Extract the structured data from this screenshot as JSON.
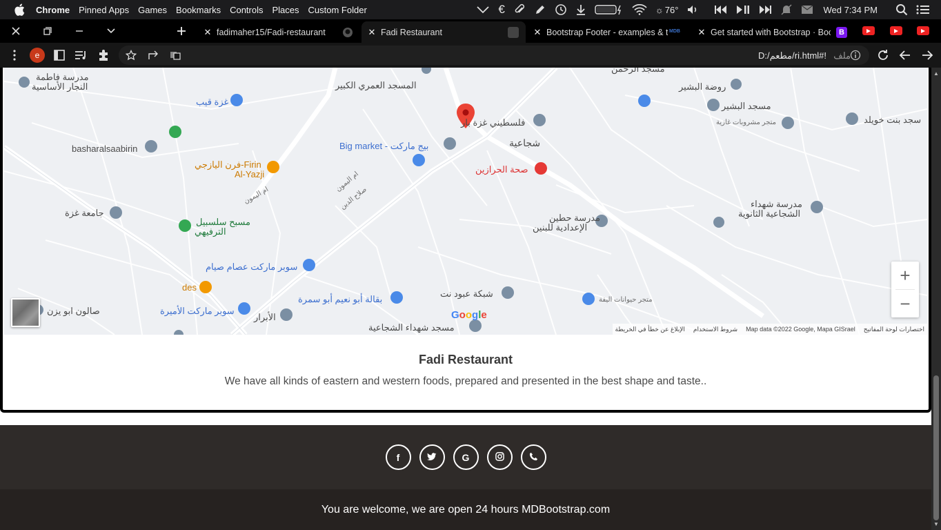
{
  "menubar": {
    "app": "Chrome",
    "items": [
      "Pinned Apps",
      "Games",
      "Bookmarks",
      "Controls",
      "Places",
      "Custom Folder"
    ],
    "weather": "76°",
    "clock": "Wed 7:34 PM"
  },
  "tabs": [
    {
      "title": "fadimaher15/Fadi-restaurant",
      "favicon": "github-icon"
    },
    {
      "title": "Fadi Restaurant",
      "favicon": "page-icon",
      "active": true
    },
    {
      "title": "Bootstrap Footer - examples & tu",
      "favicon": "mdb-icon"
    },
    {
      "title": "Get started with Bootstrap · Boot",
      "favicon": "bootstrap-icon"
    }
  ],
  "toolbar": {
    "profile_initial": "e",
    "file_label": "ملف",
    "url": "D:/مطعم/ri.html#!"
  },
  "map": {
    "labels": {
      "school_fatima": "مدرسة فاطمة",
      "school_fatima2": "النجار الأساسية",
      "omari_mosque": "المسجد العمري الكبير",
      "gaza_gift": "غزة قيب",
      "basharalsaabirin": "basharalsaabirin",
      "firin1": "فرن اليازجي-Firin",
      "firin2": "Al-Yazji",
      "big_market": "Big market - بيج ماركت",
      "palestinian_gaza": "فلسطيني غزة بار",
      "shujaiya": "شجاعية",
      "sihat": "صحة الحرازين",
      "bashir_garden": "روضة البشير",
      "bashir_mosque": "مسجد البشير",
      "drinks_store": "متجر مشروبات غازية",
      "beit_khawla": "سجد بنت خويلد",
      "gaza_univ": "جامعة غزة",
      "salsabeel1": "مسبح سلسبيل",
      "salsabeel2": "الترفيهي",
      "hitteen1": "مدرسة حطين",
      "hitteen2": "الإعدادية للبنين",
      "martyrs_school1": "مدرسة شهداء",
      "martyrs_school2": "الشجاعية الثانوية",
      "issam_market": "سوبر ماركت عصام صيام",
      "des": "des",
      "abu_naeem": "بقالة أبو نعيم أبو سمرة",
      "abboud_net": "شبكة عبود نت",
      "pet_store": "متجر حيوانات اليفة",
      "abu_yazan": "صالون ابو يزن",
      "princess_market": "سوبر ماركت الأميرة",
      "abrar": "الأبرار",
      "martyrs_mosque": "مسجد شهداء الشجاعية",
      "salah_din": "صلاح الدين",
      "yarmouk": "ام اليمون",
      "yarmouk2": "ام اليمون",
      "rahman_mosque": "مسجد الرحمن"
    },
    "google": "Google",
    "zoom_in": "+",
    "zoom_out": "−",
    "attribution": {
      "shortcuts": "اختصارات لوحة المفاتيح",
      "map_data": "Map data ©2022 Google, Mapa GISrael",
      "terms": "شروط الاستخدام",
      "report": "الإبلاغ عن خطأ في الخريطة"
    }
  },
  "card": {
    "title": "Fadi Restaurant",
    "text": "We have all kinds of eastern and western foods, prepared and presented in the best shape and taste.."
  },
  "social": [
    {
      "name": "facebook-icon",
      "glyph": "f"
    },
    {
      "name": "twitter-icon",
      "glyph": "🐦"
    },
    {
      "name": "google-icon",
      "glyph": "G"
    },
    {
      "name": "instagram-icon",
      "glyph": "◎"
    },
    {
      "name": "phone-icon",
      "glyph": "✆"
    }
  ],
  "footer": {
    "text": "You are welcome, we are open 24 hours MDBootstrap.com"
  },
  "colors": {
    "menubar_bg": "#1c1c1e",
    "footer_social_bg": "#2f2b29",
    "footer_bottom_bg": "#262220",
    "map_bg": "#eef0f3",
    "marker_red": "#ea4335"
  }
}
